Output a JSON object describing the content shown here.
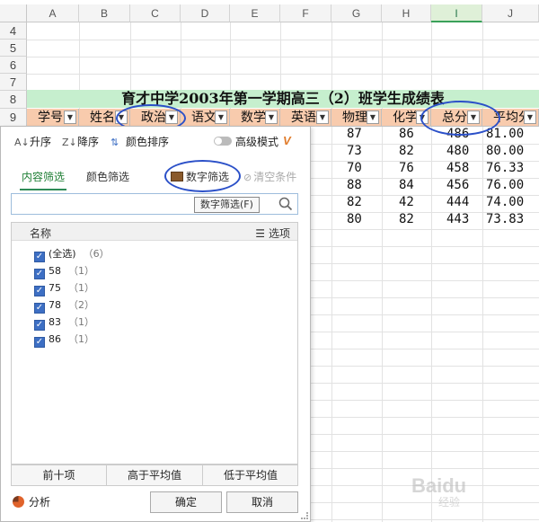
{
  "columns": [
    "A",
    "B",
    "C",
    "D",
    "E",
    "F",
    "G",
    "H",
    "I",
    "J"
  ],
  "rows": [
    "4",
    "5",
    "6",
    "7",
    "8",
    "9"
  ],
  "sheet_title": "育才中学2003年第一学期高三（2）班学生成绩表",
  "headers": [
    "学号",
    "姓名",
    "政治",
    "语文",
    "数学",
    "英语",
    "物理",
    "化学",
    "总分",
    "平均分"
  ],
  "data_rows": [
    [
      "87",
      "86",
      "486",
      "81.00"
    ],
    [
      "73",
      "82",
      "480",
      "80.00"
    ],
    [
      "70",
      "76",
      "458",
      "76.33"
    ],
    [
      "88",
      "84",
      "456",
      "76.00"
    ],
    [
      "82",
      "42",
      "444",
      "74.00"
    ],
    [
      "80",
      "82",
      "443",
      "73.83"
    ]
  ],
  "colors": {
    "title_bg": "#c6efce",
    "header_bg": "#f8cbad",
    "accent_green": "#2e8b57",
    "annotation_blue": "#2b50c8"
  },
  "panel": {
    "sort_asc": "升序",
    "sort_desc": "降序",
    "color_sort": "颜色排序",
    "advanced_mode": "高级模式",
    "tab_content": "内容筛选",
    "tab_color": "颜色筛选",
    "tab_number": "数字筛选",
    "tab_clear": "清空条件",
    "tooltip": "数字筛选(F)",
    "search_placeholder": "",
    "list_header_name": "名称",
    "list_header_options": "选项",
    "items": [
      {
        "label": "(全选)",
        "count": "（6）"
      },
      {
        "label": "58",
        "count": "（1）"
      },
      {
        "label": "75",
        "count": "（1）"
      },
      {
        "label": "78",
        "count": "（2）"
      },
      {
        "label": "83",
        "count": "（1）"
      },
      {
        "label": "86",
        "count": "（1）"
      }
    ],
    "top_ten": "前十项",
    "above_avg": "高于平均值",
    "below_avg": "低于平均值",
    "analyze": "分析",
    "ok": "确定",
    "cancel": "取消"
  },
  "icons": [
    "sort-asc-icon",
    "sort-desc-icon",
    "color-sort-icon",
    "advanced-mode-toggle",
    "v-logo-icon",
    "number-filter-icon",
    "clear-filter-icon",
    "search-icon",
    "options-icon",
    "pie-chart-icon",
    "dropdown-arrow-icon"
  ],
  "watermark": {
    "brand": "Baidu",
    "sub": "经验"
  }
}
